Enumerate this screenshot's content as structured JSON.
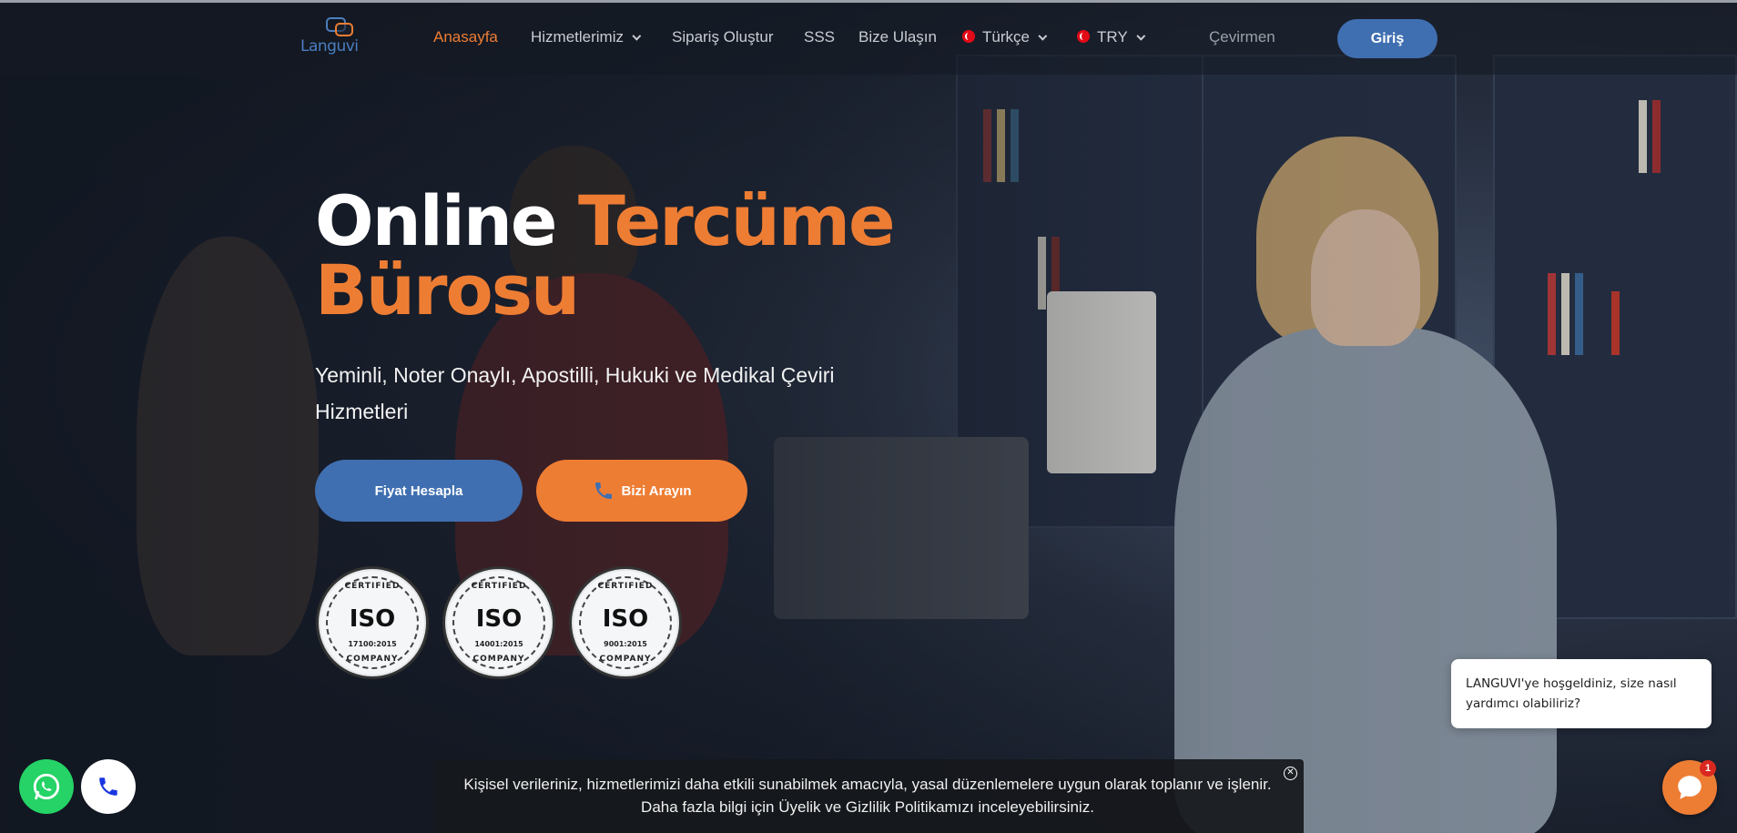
{
  "nav": {
    "logo_text": "Languvi",
    "items": [
      {
        "label": "Anasayfa",
        "active": true
      },
      {
        "label": "Hizmetlerimiz"
      },
      {
        "label": "Sipariş Oluştur"
      },
      {
        "label": "SSS"
      },
      {
        "label": "Bize Ulaşın"
      }
    ],
    "language": "Türkçe",
    "currency": "TRY",
    "translator_link": "Çevirmen",
    "login": "Giriş"
  },
  "hero": {
    "title_part1": "Online",
    "title_part2": "Tercüme",
    "title_part3": "Bürosu",
    "subtitle": "Yeminli, Noter Onaylı, Apostilli, Hukuki ve Medikal Çeviri Hizmetleri",
    "btn_price": "Fiyat Hesapla",
    "btn_call": "Bizi Arayın"
  },
  "badges": [
    {
      "top": "CERTIFIED",
      "name": "ISO",
      "standard": "17100:2015",
      "bottom": "COMPANY"
    },
    {
      "top": "CERTIFIED",
      "name": "ISO",
      "standard": "14001:2015",
      "bottom": "COMPANY"
    },
    {
      "top": "CERTIFIED",
      "name": "ISO",
      "standard": "9001:2015",
      "bottom": "COMPANY"
    }
  ],
  "cookie": {
    "text": "Kişisel verileriniz, hizmetlerimizi daha etkili sunabilmek amacıyla, yasal düzenlemelere uygun olarak toplanır ve işlenir. Daha fazla bilgi için Üyelik ve Gizlilik Politikamızı inceleyebilirsiniz.",
    "close": "✕"
  },
  "chat": {
    "greeting": "LANGUVI'ye hoşgeldiniz, size nasıl yardımcı olabiliriz?",
    "unread": "1"
  },
  "colors": {
    "accent_orange": "#ee7d34",
    "brand_blue": "#3f6fb1",
    "whatsapp_green": "#25d366"
  },
  "icons": [
    "chevron-down-icon",
    "turkey-flag-icon",
    "phone-icon",
    "whatsapp-icon",
    "chat-icon",
    "close-icon"
  ]
}
